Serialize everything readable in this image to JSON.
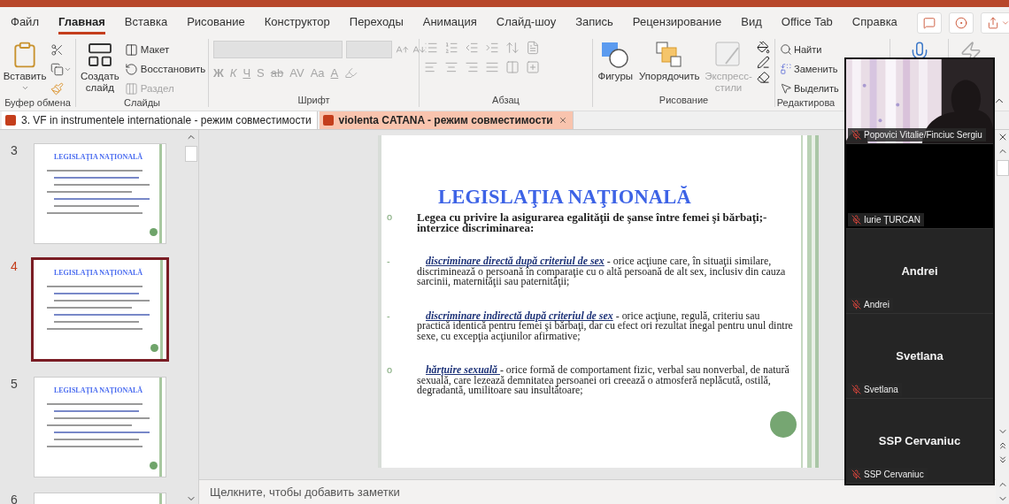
{
  "menu_tabs": [
    {
      "label": "Файл",
      "selected": false
    },
    {
      "label": "Главная",
      "selected": true
    },
    {
      "label": "Вставка",
      "selected": false
    },
    {
      "label": "Рисование",
      "selected": false
    },
    {
      "label": "Конструктор",
      "selected": false
    },
    {
      "label": "Переходы",
      "selected": false
    },
    {
      "label": "Анимация",
      "selected": false
    },
    {
      "label": "Слайд-шоу",
      "selected": false
    },
    {
      "label": "Запись",
      "selected": false
    },
    {
      "label": "Рецензирование",
      "selected": false
    },
    {
      "label": "Вид",
      "selected": false
    },
    {
      "label": "Office Tab",
      "selected": false
    },
    {
      "label": "Справка",
      "selected": false
    }
  ],
  "ribbon": {
    "clipboard": {
      "paste": "Вставить",
      "label": "Буфер обмена"
    },
    "slides": {
      "new_slide": "Создать слайд",
      "buttons": [
        {
          "label": "Макет",
          "disabled": false
        },
        {
          "label": "Восстановить",
          "disabled": false
        },
        {
          "label": "Раздел",
          "disabled": true
        }
      ],
      "label": "Слайды"
    },
    "font": {
      "disabled": true,
      "buttons": [
        {
          "label": "Ж",
          "kind": "bold"
        },
        {
          "label": "К",
          "kind": "italic"
        },
        {
          "label": "Ч",
          "kind": "underline"
        },
        {
          "label": "S",
          "kind": "shadow"
        },
        {
          "label": "ab",
          "kind": "strike"
        },
        {
          "label": "AV",
          "kind": "spacing"
        },
        {
          "label": "Aa",
          "kind": "case"
        },
        {
          "label": "A",
          "kind": "color"
        }
      ],
      "label": "Шрифт"
    },
    "paragraph": {
      "disabled": true,
      "label": "Абзац"
    },
    "drawing": {
      "buttons": [
        {
          "label": "Фигуры",
          "kind": "shapes",
          "disabled": false
        },
        {
          "label": "Упорядочить",
          "kind": "arrange",
          "disabled": false
        },
        {
          "label": "Экспресс-стили",
          "kind": "styles",
          "disabled": true
        }
      ],
      "label": "Рисование"
    },
    "editing": {
      "buttons": [
        {
          "label": "Найти",
          "kind": "find"
        },
        {
          "label": "Заменить",
          "kind": "replace"
        },
        {
          "label": "Выделить",
          "kind": "select"
        }
      ],
      "label": "Редактирова"
    }
  },
  "doc_tabs": [
    {
      "label": "3. VF in instrumentele  internationale  -  режим совместимости",
      "selected": false
    },
    {
      "label": "violenta CATANA  -  режим совместимости",
      "selected": true
    }
  ],
  "thumbnails": [
    {
      "number": "3",
      "title": "LEGISLAŢIA NAŢIONALĂ",
      "selected": false
    },
    {
      "number": "4",
      "title": "LEGISLAŢIA NAŢIONALĂ",
      "selected": true
    },
    {
      "number": "5",
      "title": "LEGISLAŢIA NAŢIONALĂ",
      "selected": false
    },
    {
      "number": "6",
      "selected": false
    }
  ],
  "slide": {
    "title": "LEGISLAŢIA NAŢIONALĂ",
    "items": [
      {
        "marker": "o",
        "kind": "heading",
        "text": "Legea cu privire la asigurarea egalităţii de şanse între femei şi bărbaţi;- interzice discriminarea:"
      },
      {
        "marker": "-",
        "kind": "definition",
        "term": "discriminare directă după criteriul de sex",
        "text": " - orice acţiune care, în situaţii similare, discriminează  o persoană în comparaţie cu o altă persoană de alt sex, inclusiv din cauza sarcinii, maternităţii sau paternităţii;"
      },
      {
        "marker": "-",
        "kind": "definition",
        "term": "discriminare indirectă după criteriul de sex",
        "text": " - orice acţiune, regulă, criteriu sau practică identică pentru femei şi bărbaţi, dar cu efect ori rezultat inegal  pentru unul dintre sexe,  cu excepţia acţiunilor afirmative;"
      },
      {
        "marker": "o",
        "kind": "definition",
        "term": "hărţuire sexuală ",
        "text": " - orice formă de comportament fizic, verbal sau nonverbal, de natură sexuală, care lezează demnitatea persoanei ori creează o atmosferă neplăcută, ostilă, degradantă, umilitoare sau insultătoare;"
      }
    ]
  },
  "notes": {
    "placeholder": "Щелкните, чтобы добавить заметки"
  },
  "participants": [
    {
      "kind": "video",
      "name": "Popovici Vitalie/Finciuc Sergiu",
      "muted": true
    },
    {
      "kind": "blank",
      "name": "Iurie ȚURCAN",
      "muted": true
    },
    {
      "kind": "avatar",
      "caption": "Andrei",
      "name": "Andrei",
      "muted": true
    },
    {
      "kind": "avatar",
      "caption": "Svetlana",
      "name": "Svetlana",
      "muted": true
    },
    {
      "kind": "avatar",
      "caption": "SSP Cervaniuc",
      "name": "SSP Cervaniuc",
      "muted": true
    }
  ]
}
